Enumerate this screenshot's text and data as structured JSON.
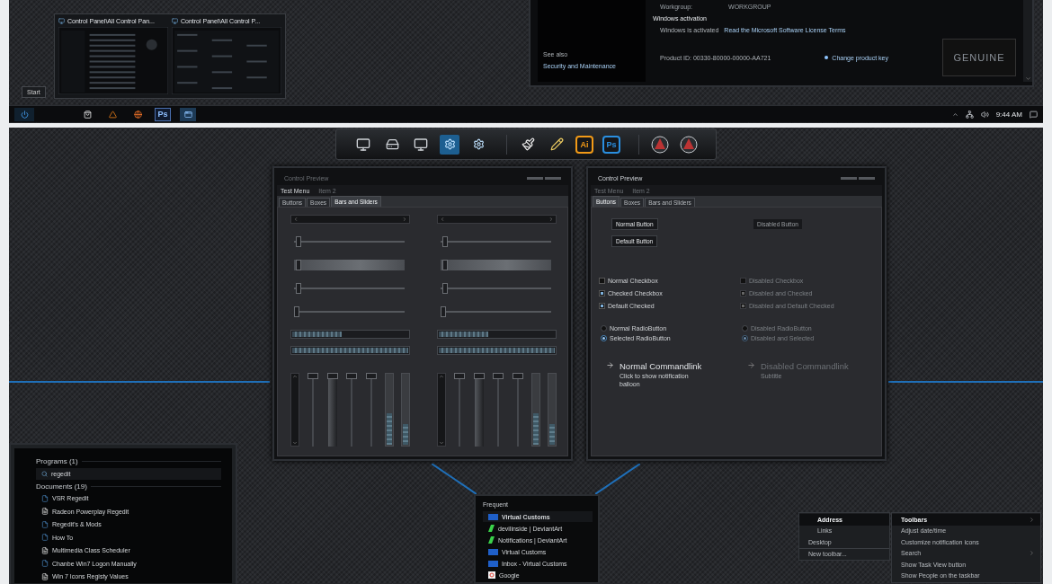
{
  "top_screenshot": {
    "thumbnails": [
      {
        "title": "Control Panel\\All Control Pan..."
      },
      {
        "title": "Control Panel\\All Control P..."
      }
    ],
    "start_tooltip": "Start",
    "system_window": {
      "workgroup_label": "Workgroup:",
      "workgroup_value": "WORKGROUP",
      "see_also": "See also",
      "see_also_link": "Security and Maintenance",
      "activation_heading": "Windows activation",
      "activation_status": "Windows is activated",
      "license_link": "Read the Microsoft Software License Terms",
      "product_id": "Product ID: 00330-80000-00000-AA721",
      "change_key_link": "Change product key",
      "genuine_badge": "GENUINE"
    },
    "taskbar": {
      "start_button": {
        "selected": true
      },
      "apps": [
        {
          "kind": "store",
          "selected": false
        },
        {
          "kind": "cone",
          "selected": false
        },
        {
          "kind": "browser",
          "selected": false
        },
        {
          "kind": "photoshop",
          "label": "Ps",
          "selected": false
        },
        {
          "kind": "window",
          "selected": true
        }
      ],
      "clock": "9:44 AM"
    }
  },
  "bottom_screenshot": {
    "dock": {
      "groups": [
        [
          {
            "kind": "monitor",
            "selected": false
          },
          {
            "kind": "disk",
            "selected": false
          },
          {
            "kind": "monitor",
            "selected": false
          },
          {
            "kind": "settings",
            "selected": true
          },
          {
            "kind": "settings",
            "selected": false
          }
        ],
        [
          {
            "kind": "brush",
            "selected": false
          },
          {
            "kind": "pencils",
            "selected": false
          },
          {
            "kind": "app",
            "label": "Ai",
            "color": "#f29a17",
            "selected": false
          },
          {
            "kind": "app",
            "label": "Ps",
            "color": "#2a8fe0",
            "selected": false
          }
        ],
        [
          {
            "kind": "emblem",
            "selected": false
          },
          {
            "kind": "emblem",
            "selected": false
          }
        ]
      ]
    },
    "windows": [
      {
        "title": "Control Preview",
        "focused": false,
        "menu": [
          "Test Menu",
          "Item 2"
        ],
        "tabs": [
          {
            "label": "Buttons",
            "selected": false
          },
          {
            "label": "Boxes",
            "selected": false
          },
          {
            "label": "Bars and Sliders",
            "selected": true
          }
        ],
        "page": {
          "kind": "bars",
          "columns": [
            {
              "sliders": [
                {
                  "kind": "line",
                  "level": 0.02
                },
                {
                  "kind": "wide",
                  "level": 0.02
                },
                {
                  "kind": "line",
                  "level": 0.02
                },
                {
                  "kind": "line",
                  "level": 0
                }
              ],
              "progress": [
                {
                  "level": 0.43
                },
                {
                  "level": 1
                }
              ],
              "vertical_sliders": [
                {
                  "kind": "line",
                  "level": 1
                },
                {
                  "kind": "wide",
                  "level": 1
                },
                {
                  "kind": "line",
                  "level": 1
                },
                {
                  "kind": "line",
                  "level": 1
                }
              ],
              "vertical_progress": [
                {
                  "level": 0.45
                },
                {
                  "level": 0.3
                }
              ]
            },
            {
              "sliders": [
                {
                  "kind": "line",
                  "level": 0.02
                },
                {
                  "kind": "wide",
                  "level": 0.02
                },
                {
                  "kind": "line",
                  "level": 0.02
                },
                {
                  "kind": "line",
                  "level": 0
                }
              ],
              "progress": [
                {
                  "level": 0.43
                },
                {
                  "level": 1
                }
              ],
              "vertical_sliders": [
                {
                  "kind": "line",
                  "level": 1
                },
                {
                  "kind": "wide",
                  "level": 1
                },
                {
                  "kind": "line",
                  "level": 1
                },
                {
                  "kind": "line",
                  "level": 1
                }
              ],
              "vertical_progress": [
                {
                  "level": 0.45
                },
                {
                  "level": 0.3
                }
              ]
            }
          ]
        }
      },
      {
        "title": "Control Preview",
        "focused": true,
        "menu": [
          "Test Menu",
          "Item 2"
        ],
        "tabs": [
          {
            "label": "Buttons",
            "selected": true
          },
          {
            "label": "Boxes",
            "selected": false
          },
          {
            "label": "Bars and Sliders",
            "selected": false
          }
        ],
        "page": {
          "kind": "buttons",
          "columns": [
            {
              "buttons": [
                {
                  "label": "Normal Button",
                  "disabled": false
                },
                {
                  "label": "Default Button",
                  "disabled": false
                }
              ],
              "checkboxes": [
                {
                  "label": "Normal Checkbox",
                  "checked": false,
                  "disabled": false
                },
                {
                  "label": "Checked Checkbox",
                  "checked": true,
                  "disabled": false
                },
                {
                  "label": "Default Checked",
                  "checked": true,
                  "disabled": false
                }
              ],
              "radios": [
                {
                  "label": "Normal RadioButton",
                  "selected": false,
                  "disabled": false
                },
                {
                  "label": "Selected RadioButton",
                  "selected": true,
                  "disabled": false
                }
              ],
              "command_link": {
                "title": "Normal Commandlink",
                "subtitle": "Click to show notification balloon",
                "disabled": false
              }
            },
            {
              "buttons": [
                {
                  "label": "Disabled Button",
                  "disabled": true
                }
              ],
              "checkboxes": [
                {
                  "label": "Disabled Checkbox",
                  "checked": false,
                  "disabled": true
                },
                {
                  "label": "Disabled and Checked",
                  "checked": true,
                  "disabled": true
                },
                {
                  "label": "Disabled and Default Checked",
                  "checked": true,
                  "disabled": true
                }
              ],
              "radios": [
                {
                  "label": "Disabled RadioButton",
                  "selected": false,
                  "disabled": true
                },
                {
                  "label": "Disabled and Selected",
                  "selected": true,
                  "disabled": true
                }
              ],
              "command_link": {
                "title": "Disabled Commandlink",
                "subtitle": "Subtitle",
                "disabled": true
              }
            }
          ]
        }
      }
    ],
    "search_results": {
      "groups": [
        {
          "heading": "Programs (1)",
          "items": [
            {
              "kind": "program",
              "label": "regedit",
              "selected": true
            }
          ]
        },
        {
          "heading": "Documents (19)",
          "items": [
            {
              "kind": "doc",
              "label": "VSR Regedit",
              "selected": false
            },
            {
              "kind": "text",
              "label": "Radeon Powerplay Regedit",
              "selected": false
            },
            {
              "kind": "doc",
              "label": "Regedit's & Mods",
              "selected": false
            },
            {
              "kind": "doc",
              "label": "How To",
              "selected": false
            },
            {
              "kind": "text",
              "label": "Multimedia Class Scheduler",
              "selected": false
            },
            {
              "kind": "doc",
              "label": "Chanbe Win7 Logon Manually",
              "selected": false
            },
            {
              "kind": "text",
              "label": "Win 7 Icons Registy Values",
              "selected": false
            }
          ]
        }
      ]
    },
    "jump_list": {
      "heading": "Frequent",
      "items": [
        {
          "kind": "site",
          "label": "Virtual Customs",
          "selected": true
        },
        {
          "kind": "art",
          "label": "devilinside | DeviantArt",
          "selected": false
        },
        {
          "kind": "art",
          "label": "Notifications | DeviantArt",
          "selected": false
        },
        {
          "kind": "site",
          "label": "Virtual Customs",
          "selected": false
        },
        {
          "kind": "site",
          "label": "Inbox - Virtual Customs",
          "selected": false
        },
        {
          "kind": "search",
          "label": "Google",
          "selected": false
        }
      ]
    },
    "context_menus": [
      {
        "items": [
          {
            "label": "Address",
            "indented": true,
            "selected": true,
            "submenu": false,
            "separator_before": false
          },
          {
            "label": "Links",
            "indented": true,
            "selected": false,
            "submenu": false,
            "separator_before": false
          },
          {
            "label": "Desktop",
            "indented": false,
            "selected": false,
            "submenu": false,
            "separator_before": false
          },
          {
            "label": "New toolbar...",
            "indented": false,
            "selected": false,
            "submenu": false,
            "separator_before": true
          }
        ]
      },
      {
        "items": [
          {
            "label": "Toolbars",
            "indented": false,
            "selected": true,
            "submenu": true,
            "separator_before": false
          },
          {
            "label": "Adjust date/time",
            "indented": false,
            "selected": false,
            "submenu": false,
            "separator_before": false
          },
          {
            "label": "Customize notification icons",
            "indented": false,
            "selected": false,
            "submenu": false,
            "separator_before": false
          },
          {
            "label": "Search",
            "indented": false,
            "selected": false,
            "submenu": true,
            "separator_before": false
          },
          {
            "label": "Show Task View button",
            "indented": false,
            "selected": false,
            "submenu": false,
            "separator_before": false
          },
          {
            "label": "Show People on the taskbar",
            "indented": false,
            "selected": false,
            "submenu": false,
            "separator_before": false
          }
        ]
      }
    ]
  }
}
